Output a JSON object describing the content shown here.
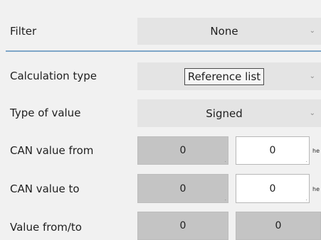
{
  "rows": {
    "filter": {
      "label": "Filter",
      "value": "None"
    },
    "calculation_type": {
      "label": "Calculation type",
      "value": "Reference list"
    },
    "type_of_value": {
      "label": "Type of value",
      "value": "Signed"
    },
    "can_value_from": {
      "label": "CAN value from",
      "left_value": "0",
      "right_value": "0",
      "unit": "he"
    },
    "can_value_to": {
      "label": "CAN value to",
      "left_value": "0",
      "right_value": "0",
      "unit": "he"
    },
    "value_from_to": {
      "label": "Value from/to",
      "left_value": "0",
      "right_value": "0"
    }
  },
  "icons": {
    "dropdown": "chevron-down-icon",
    "resize": "resize-grip-icon"
  },
  "colors": {
    "background": "#f1f1f1",
    "dropdown_bg": "#e4e4e4",
    "readonly_field": "#c4c4c4",
    "editable_field": "#ffffff",
    "separator": "#7ea6c8"
  }
}
